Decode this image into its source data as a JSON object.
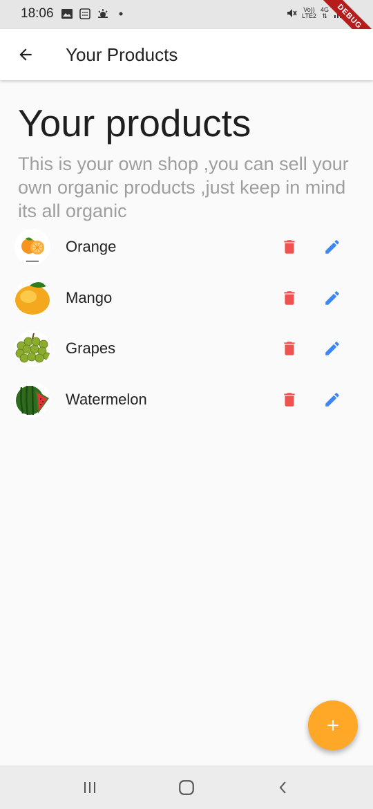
{
  "status_bar": {
    "time": "18:06",
    "network_top": "Vo))",
    "network_bottom": "LTE2",
    "signal_gen": "4G",
    "debug_label": "DEBUG"
  },
  "app_bar": {
    "title": "Your Products"
  },
  "page": {
    "heading": "Your products",
    "description": "This is your own shop ,you can sell your own organic products ,just keep in mind its all organic"
  },
  "products": [
    {
      "name": "Orange"
    },
    {
      "name": "Mango"
    },
    {
      "name": "Grapes"
    },
    {
      "name": "Watermelon"
    }
  ],
  "colors": {
    "delete": "#f0524f",
    "edit": "#3d86f5",
    "fab": "#ffa726"
  }
}
